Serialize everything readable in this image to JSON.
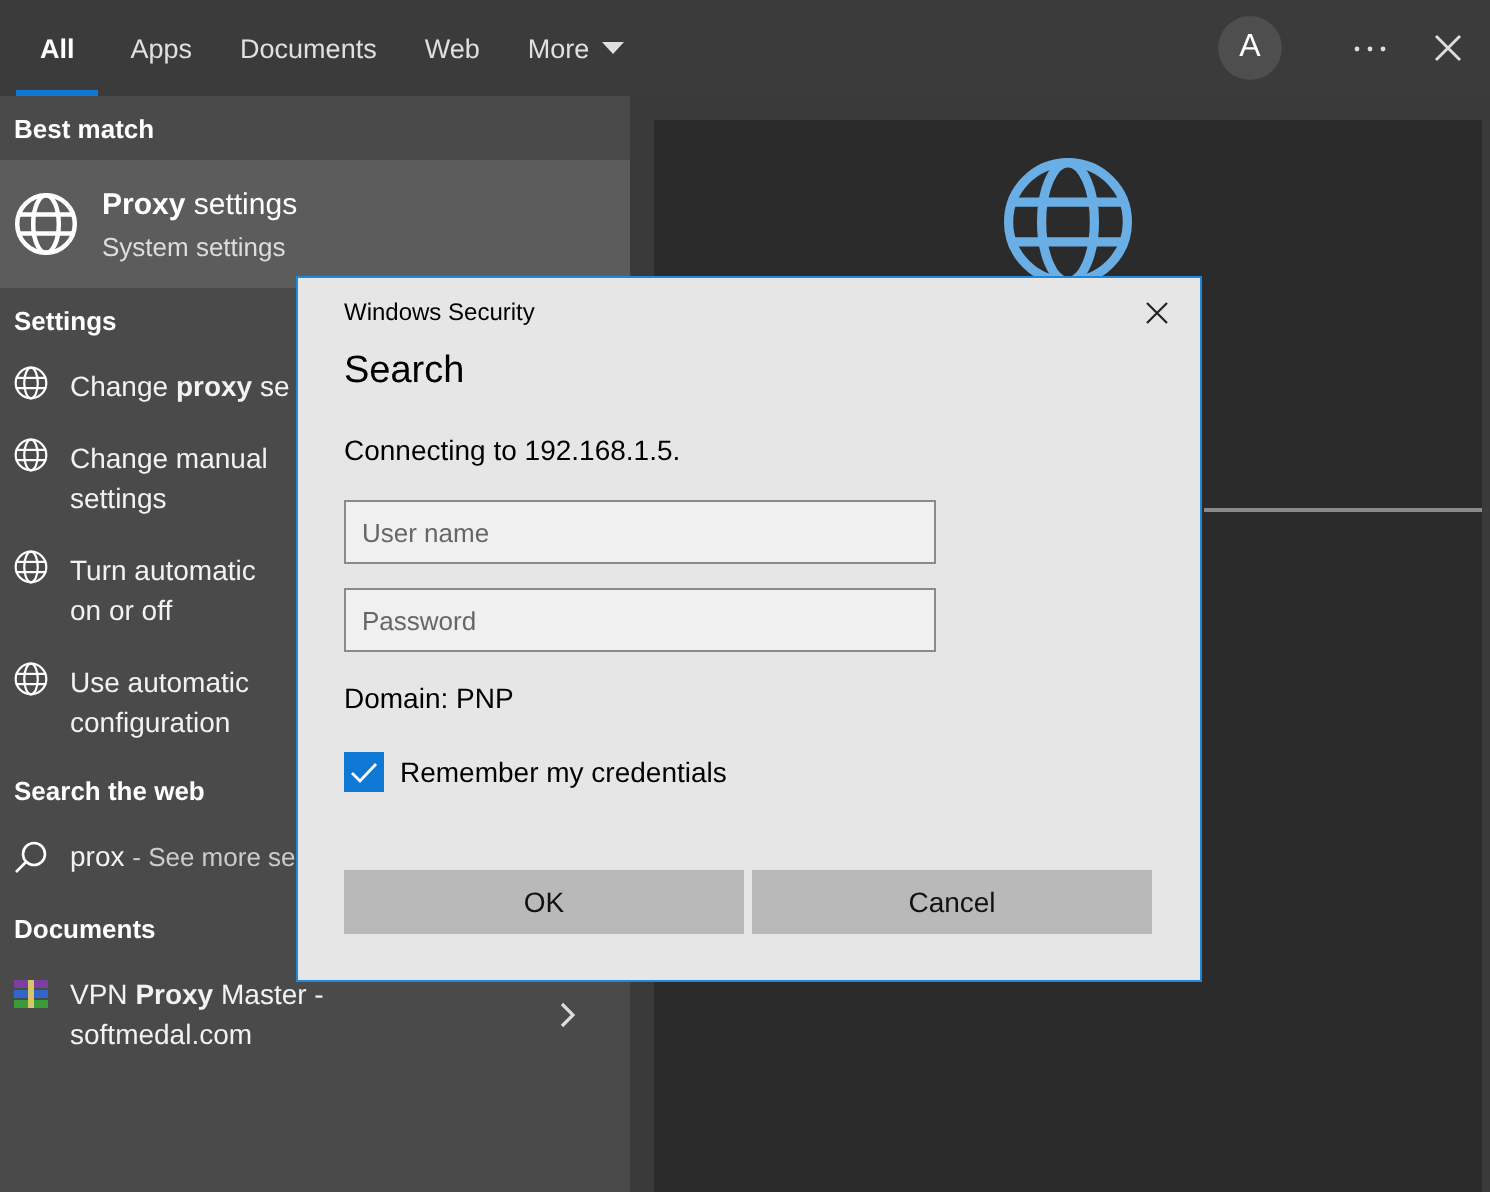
{
  "tabs": [
    {
      "label": "All",
      "selected": true,
      "kind": "tab"
    },
    {
      "label": "Apps",
      "selected": false,
      "kind": "tab"
    },
    {
      "label": "Documents",
      "selected": false,
      "kind": "tab"
    },
    {
      "label": "Web",
      "selected": false,
      "kind": "tab"
    },
    {
      "label": "More",
      "selected": false,
      "kind": "dropdown"
    }
  ],
  "avatar": "A",
  "best_match": {
    "header": "Best match",
    "title": "**Proxy** settings",
    "subtitle": "System settings"
  },
  "settings": {
    "header": "Settings",
    "items": [
      {
        "lines": [
          "Change **proxy** se"
        ]
      },
      {
        "lines": [
          "Change manual",
          "settings"
        ]
      },
      {
        "lines": [
          "Turn automatic",
          "on or off"
        ]
      },
      {
        "lines": [
          "Use automatic",
          "configuration"
        ]
      }
    ]
  },
  "web": {
    "header": "Search the web",
    "query": "prox",
    "hint": "- See more se"
  },
  "documents": {
    "header": "Documents",
    "items": [
      {
        "lines": [
          "VPN **Proxy** Master -",
          "softmedal.com"
        ]
      }
    ]
  },
  "dialog": {
    "app_title": "Windows Security",
    "title": "Search",
    "message": "Connecting to 192.168.1.5.",
    "fields": [
      {
        "placeholder": "User name"
      },
      {
        "placeholder": "Password"
      }
    ],
    "domain": "Domain: PNP",
    "remember": {
      "label": "Remember my credentials",
      "checked": true
    },
    "buttons": [
      "OK",
      "Cancel"
    ]
  }
}
